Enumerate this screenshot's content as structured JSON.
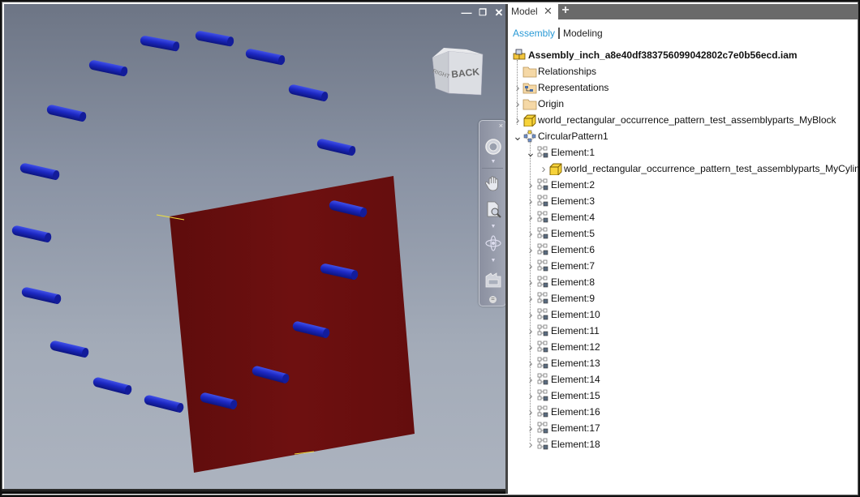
{
  "viewport": {
    "window_controls": {
      "minimize": "—",
      "restore": "❐",
      "close": "✕"
    },
    "viewcube": {
      "face_front": "BACK",
      "face_side": "RIGHT"
    },
    "navbar": {
      "tools": [
        {
          "name": "steering-wheel",
          "label": "Full Navigation Wheel"
        },
        {
          "name": "pan",
          "label": "Pan"
        },
        {
          "name": "zoom",
          "label": "Zoom"
        },
        {
          "name": "orbit",
          "label": "Orbit"
        },
        {
          "name": "view-face",
          "label": "View Face"
        }
      ],
      "close_glyph": "×"
    },
    "scene": {
      "plate_color": "#6b0e0e",
      "cylinder_color": "#1c28c2",
      "background_top": "#6d7585",
      "background_bottom": "#acb3bf"
    }
  },
  "browser": {
    "tab_label": "Model",
    "tab_close": "✕",
    "tab_add": "+",
    "modes": {
      "assembly": "Assembly",
      "modeling": "Modeling"
    },
    "root": {
      "label": "Assembly_inch_a8e40df383756099042802c7e0b56ecd.iam",
      "icon": "assembly-icon"
    },
    "items": [
      {
        "label": "Relationships",
        "icon": "folder-icon",
        "expandable": false
      },
      {
        "label": "Representations",
        "icon": "representations-icon",
        "expandable": true
      },
      {
        "label": "Origin",
        "icon": "folder-icon",
        "expandable": true
      },
      {
        "label": "world_rectangular_occurrence_pattern_test_assemblyparts_MyBlock",
        "icon": "part-icon",
        "expandable": true
      },
      {
        "label": "CircularPattern1",
        "icon": "circular-pattern-icon",
        "expandable": true,
        "expanded": true
      }
    ],
    "pattern_elements": [
      {
        "label": "Element:1",
        "expanded": true,
        "children": [
          {
            "label": "world_rectangular_occurrence_pattern_test_assemblyparts_MyCylinder",
            "icon": "part-icon"
          }
        ]
      },
      {
        "label": "Element:2"
      },
      {
        "label": "Element:3"
      },
      {
        "label": "Element:4"
      },
      {
        "label": "Element:5"
      },
      {
        "label": "Element:6"
      },
      {
        "label": "Element:7"
      },
      {
        "label": "Element:8"
      },
      {
        "label": "Element:9"
      },
      {
        "label": "Element:10"
      },
      {
        "label": "Element:11"
      },
      {
        "label": "Element:12"
      },
      {
        "label": "Element:13"
      },
      {
        "label": "Element:14"
      },
      {
        "label": "Element:15"
      },
      {
        "label": "Element:16"
      },
      {
        "label": "Element:17"
      },
      {
        "label": "Element:18"
      }
    ]
  }
}
